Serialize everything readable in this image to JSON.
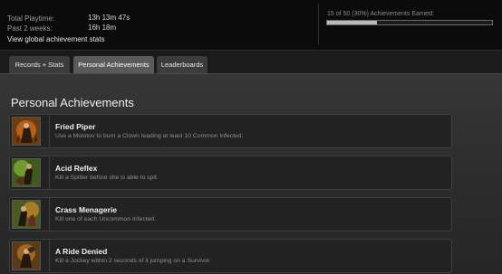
{
  "stats": {
    "total_playtime_label": "Total Playtime:",
    "total_playtime_value": "13h 13m 47s",
    "past_two_weeks_label": "Past 2 weeks:",
    "past_two_weeks_value": "16h 18m",
    "global_link": "View global achievement stats"
  },
  "achievements_progress": {
    "label": "15 of 50 (30%) Achievements Earned:",
    "earned": 15,
    "total": 50,
    "fraction": 0.3
  },
  "tabs": [
    {
      "label": "Records + Stats",
      "active": false
    },
    {
      "label": "Personal Achievements",
      "active": true
    },
    {
      "label": "Leaderboards",
      "active": false
    }
  ],
  "section_title": "Personal Achievements",
  "achievements": [
    {
      "name": "Fried Piper",
      "description": "Use a Molotov to burn a Clown leading at least 10 Common Infected.",
      "icon": "fried-piper-icon"
    },
    {
      "name": "Acid Reflex",
      "description": "Kill a Spitter before she is able to spit.",
      "icon": "acid-reflex-icon"
    },
    {
      "name": "Crass Menagerie",
      "description": "Kill one of each Uncommon Infected.",
      "icon": "crass-menagerie-icon"
    },
    {
      "name": "A Ride Denied",
      "description": "Kill a Jockey within 2 seconds of it jumping on a Survivor.",
      "icon": "a-ride-denied-icon"
    }
  ]
}
